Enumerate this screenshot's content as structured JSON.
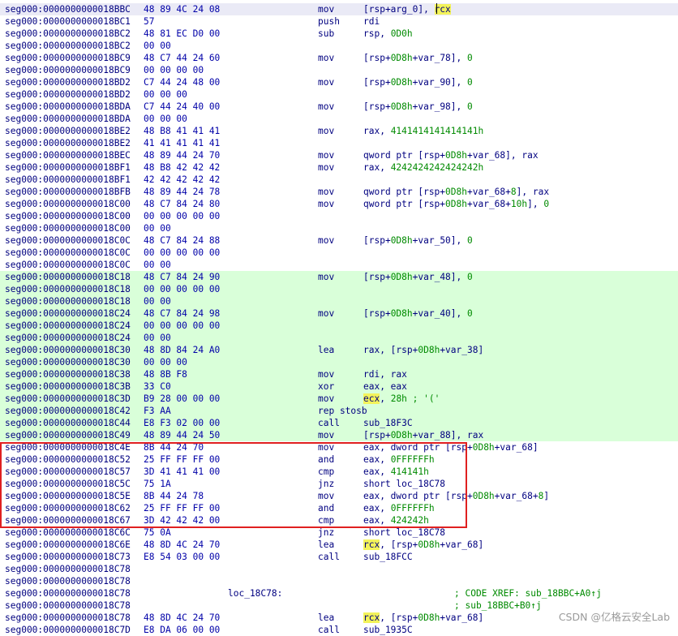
{
  "colors": {
    "background": "#ffffff",
    "address": "#000080",
    "bytes": "#0000a8",
    "numbers": "#008a00",
    "comments": "#008a00",
    "operand_highlight": "#f3f35a",
    "executed_block": "#d9ffd9",
    "red_box": "#e02020"
  },
  "lines": [
    {
      "addr": "seg000:0000000000018BBC",
      "bytes": "48 89 4C 24 08",
      "mnem": "mov",
      "ops": [
        {
          "t": "[rsp+arg_0], "
        },
        {
          "t": "rcx",
          "k": "hl"
        }
      ],
      "bg": "cur"
    },
    {
      "addr": "seg000:0000000000018BC1",
      "bytes": "57",
      "mnem": "push",
      "ops": [
        {
          "t": "rdi"
        }
      ]
    },
    {
      "addr": "seg000:0000000000018BC2",
      "bytes": "48 81 EC D0 00",
      "mnem": "sub",
      "ops": [
        {
          "t": "rsp, "
        },
        {
          "t": "0D0h",
          "k": "num"
        }
      ]
    },
    {
      "addr": "seg000:0000000000018BC2",
      "bytes": "00 00"
    },
    {
      "addr": "seg000:0000000000018BC9",
      "bytes": "48 C7 44 24 60",
      "mnem": "mov",
      "ops": [
        {
          "t": "[rsp+"
        },
        {
          "t": "0D8h",
          "k": "num"
        },
        {
          "t": "+var_78], "
        },
        {
          "t": "0",
          "k": "num"
        }
      ]
    },
    {
      "addr": "seg000:0000000000018BC9",
      "bytes": "00 00 00 00"
    },
    {
      "addr": "seg000:0000000000018BD2",
      "bytes": "C7 44 24 48 00",
      "mnem": "mov",
      "ops": [
        {
          "t": "[rsp+"
        },
        {
          "t": "0D8h",
          "k": "num"
        },
        {
          "t": "+var_90], "
        },
        {
          "t": "0",
          "k": "num"
        }
      ]
    },
    {
      "addr": "seg000:0000000000018BD2",
      "bytes": "00 00 00"
    },
    {
      "addr": "seg000:0000000000018BDA",
      "bytes": "C7 44 24 40 00",
      "mnem": "mov",
      "ops": [
        {
          "t": "[rsp+"
        },
        {
          "t": "0D8h",
          "k": "num"
        },
        {
          "t": "+var_98], "
        },
        {
          "t": "0",
          "k": "num"
        }
      ]
    },
    {
      "addr": "seg000:0000000000018BDA",
      "bytes": "00 00 00"
    },
    {
      "addr": "seg000:0000000000018BE2",
      "bytes": "48 B8 41 41 41",
      "mnem": "mov",
      "ops": [
        {
          "t": "rax, "
        },
        {
          "t": "4141414141414141h",
          "k": "num"
        }
      ]
    },
    {
      "addr": "seg000:0000000000018BE2",
      "bytes": "41 41 41 41 41"
    },
    {
      "addr": "seg000:0000000000018BEC",
      "bytes": "48 89 44 24 70",
      "mnem": "mov",
      "ops": [
        {
          "t": "qword ptr [rsp+"
        },
        {
          "t": "0D8h",
          "k": "num"
        },
        {
          "t": "+var_68], rax"
        }
      ]
    },
    {
      "addr": "seg000:0000000000018BF1",
      "bytes": "48 B8 42 42 42",
      "mnem": "mov",
      "ops": [
        {
          "t": "rax, "
        },
        {
          "t": "4242424242424242h",
          "k": "num"
        }
      ]
    },
    {
      "addr": "seg000:0000000000018BF1",
      "bytes": "42 42 42 42 42"
    },
    {
      "addr": "seg000:0000000000018BFB",
      "bytes": "48 89 44 24 78",
      "mnem": "mov",
      "ops": [
        {
          "t": "qword ptr [rsp+"
        },
        {
          "t": "0D8h",
          "k": "num"
        },
        {
          "t": "+var_68+"
        },
        {
          "t": "8",
          "k": "num"
        },
        {
          "t": "], rax"
        }
      ]
    },
    {
      "addr": "seg000:0000000000018C00",
      "bytes": "48 C7 84 24 80",
      "mnem": "mov",
      "ops": [
        {
          "t": "qword ptr [rsp+"
        },
        {
          "t": "0D8h",
          "k": "num"
        },
        {
          "t": "+var_68+"
        },
        {
          "t": "10h",
          "k": "num"
        },
        {
          "t": "], "
        },
        {
          "t": "0",
          "k": "num"
        }
      ]
    },
    {
      "addr": "seg000:0000000000018C00",
      "bytes": "00 00 00 00 00"
    },
    {
      "addr": "seg000:0000000000018C00",
      "bytes": "00 00"
    },
    {
      "addr": "seg000:0000000000018C0C",
      "bytes": "48 C7 84 24 88",
      "mnem": "mov",
      "ops": [
        {
          "t": "[rsp+"
        },
        {
          "t": "0D8h",
          "k": "num"
        },
        {
          "t": "+var_50], "
        },
        {
          "t": "0",
          "k": "num"
        }
      ]
    },
    {
      "addr": "seg000:0000000000018C0C",
      "bytes": "00 00 00 00 00"
    },
    {
      "addr": "seg000:0000000000018C0C",
      "bytes": "00 00"
    },
    {
      "addr": "seg000:0000000000018C18",
      "bytes": "48 C7 84 24 90",
      "mnem": "mov",
      "ops": [
        {
          "t": "[rsp+"
        },
        {
          "t": "0D8h",
          "k": "num"
        },
        {
          "t": "+var_48], "
        },
        {
          "t": "0",
          "k": "num"
        }
      ],
      "bg": "green"
    },
    {
      "addr": "seg000:0000000000018C18",
      "bytes": "00 00 00 00 00",
      "bg": "green"
    },
    {
      "addr": "seg000:0000000000018C18",
      "bytes": "00 00",
      "bg": "green"
    },
    {
      "addr": "seg000:0000000000018C24",
      "bytes": "48 C7 84 24 98",
      "mnem": "mov",
      "ops": [
        {
          "t": "[rsp+"
        },
        {
          "t": "0D8h",
          "k": "num"
        },
        {
          "t": "+var_40], "
        },
        {
          "t": "0",
          "k": "num"
        }
      ],
      "bg": "green"
    },
    {
      "addr": "seg000:0000000000018C24",
      "bytes": "00 00 00 00 00",
      "bg": "green"
    },
    {
      "addr": "seg000:0000000000018C24",
      "bytes": "00 00",
      "bg": "green"
    },
    {
      "addr": "seg000:0000000000018C30",
      "bytes": "48 8D 84 24 A0",
      "mnem": "lea",
      "ops": [
        {
          "t": "rax, [rsp+"
        },
        {
          "t": "0D8h",
          "k": "num"
        },
        {
          "t": "+var_38]"
        }
      ],
      "bg": "green"
    },
    {
      "addr": "seg000:0000000000018C30",
      "bytes": "00 00 00",
      "bg": "green"
    },
    {
      "addr": "seg000:0000000000018C38",
      "bytes": "48 8B F8",
      "mnem": "mov",
      "ops": [
        {
          "t": "rdi, rax"
        }
      ],
      "bg": "green"
    },
    {
      "addr": "seg000:0000000000018C3B",
      "bytes": "33 C0",
      "mnem": "xor",
      "ops": [
        {
          "t": "eax, eax"
        }
      ],
      "bg": "green"
    },
    {
      "addr": "seg000:0000000000018C3D",
      "bytes": "B9 28 00 00 00",
      "mnem": "mov",
      "ops": [
        {
          "t": "ecx",
          "k": "hl"
        },
        {
          "t": ", "
        },
        {
          "t": "28h",
          "k": "num"
        },
        {
          "t": " ; '('",
          "k": "num"
        }
      ],
      "bg": "green"
    },
    {
      "addr": "seg000:0000000000018C42",
      "bytes": "F3 AA",
      "mnem": "rep stosb",
      "ops": [],
      "bg": "green"
    },
    {
      "addr": "seg000:0000000000018C44",
      "bytes": "E8 F3 02 00 00",
      "mnem": "call",
      "ops": [
        {
          "t": "sub_18F3C"
        }
      ],
      "bg": "green"
    },
    {
      "addr": "seg000:0000000000018C49",
      "bytes": "48 89 44 24 50",
      "mnem": "mov",
      "ops": [
        {
          "t": "[rsp+"
        },
        {
          "t": "0D8h",
          "k": "num"
        },
        {
          "t": "+var_88], rax"
        }
      ],
      "bg": "green"
    },
    {
      "addr": "seg000:0000000000018C4E",
      "bytes": "8B 44 24 70",
      "mnem": "mov",
      "ops": [
        {
          "t": "eax, dword ptr [rsp+"
        },
        {
          "t": "0D8h",
          "k": "num"
        },
        {
          "t": "+var_68]"
        }
      ]
    },
    {
      "addr": "seg000:0000000000018C52",
      "bytes": "25 FF FF FF 00",
      "mnem": "and",
      "ops": [
        {
          "t": "eax, "
        },
        {
          "t": "0FFFFFFh",
          "k": "num"
        }
      ]
    },
    {
      "addr": "seg000:0000000000018C57",
      "bytes": "3D 41 41 41 00",
      "mnem": "cmp",
      "ops": [
        {
          "t": "eax, "
        },
        {
          "t": "414141h",
          "k": "num"
        }
      ]
    },
    {
      "addr": "seg000:0000000000018C5C",
      "bytes": "75 1A",
      "mnem": "jnz",
      "ops": [
        {
          "t": "short loc_18C78"
        }
      ]
    },
    {
      "addr": "seg000:0000000000018C5E",
      "bytes": "8B 44 24 78",
      "mnem": "mov",
      "ops": [
        {
          "t": "eax, dword ptr [rsp+"
        },
        {
          "t": "0D8h",
          "k": "num"
        },
        {
          "t": "+var_68+"
        },
        {
          "t": "8",
          "k": "num"
        },
        {
          "t": "]"
        }
      ]
    },
    {
      "addr": "seg000:0000000000018C62",
      "bytes": "25 FF FF FF 00",
      "mnem": "and",
      "ops": [
        {
          "t": "eax, "
        },
        {
          "t": "0FFFFFFh",
          "k": "num"
        }
      ]
    },
    {
      "addr": "seg000:0000000000018C67",
      "bytes": "3D 42 42 42 00",
      "mnem": "cmp",
      "ops": [
        {
          "t": "eax, "
        },
        {
          "t": "424242h",
          "k": "num"
        }
      ]
    },
    {
      "addr": "seg000:0000000000018C6C",
      "bytes": "75 0A",
      "mnem": "jnz",
      "ops": [
        {
          "t": "short loc_18C78"
        }
      ]
    },
    {
      "addr": "seg000:0000000000018C6E",
      "bytes": "48 8D 4C 24 70",
      "mnem": "lea",
      "ops": [
        {
          "t": "rcx",
          "k": "hl"
        },
        {
          "t": ", [rsp+"
        },
        {
          "t": "0D8h",
          "k": "num"
        },
        {
          "t": "+var_68]"
        }
      ]
    },
    {
      "addr": "seg000:0000000000018C73",
      "bytes": "E8 54 03 00 00",
      "mnem": "call",
      "ops": [
        {
          "t": "sub_18FCC"
        }
      ]
    },
    {
      "addr": "seg000:0000000000018C78"
    },
    {
      "addr": "seg000:0000000000018C78"
    },
    {
      "addr": "seg000:0000000000018C78",
      "label": "loc_18C78:",
      "comment": "; CODE XREF: sub_18BBC+A0↑j"
    },
    {
      "addr": "seg000:0000000000018C78",
      "comment": "; sub_18BBC+B0↑j"
    },
    {
      "addr": "seg000:0000000000018C78",
      "bytes": "48 8D 4C 24 70",
      "mnem": "lea",
      "ops": [
        {
          "t": "rcx",
          "k": "hl"
        },
        {
          "t": ", [rsp+"
        },
        {
          "t": "0D8h",
          "k": "num"
        },
        {
          "t": "+var_68]"
        }
      ]
    },
    {
      "addr": "seg000:0000000000018C7D",
      "bytes": "E8 DA 06 00 00",
      "mnem": "call",
      "ops": [
        {
          "t": "sub_1935C"
        }
      ]
    }
  ],
  "watermark": "CSDN @亿格云安全Lab"
}
